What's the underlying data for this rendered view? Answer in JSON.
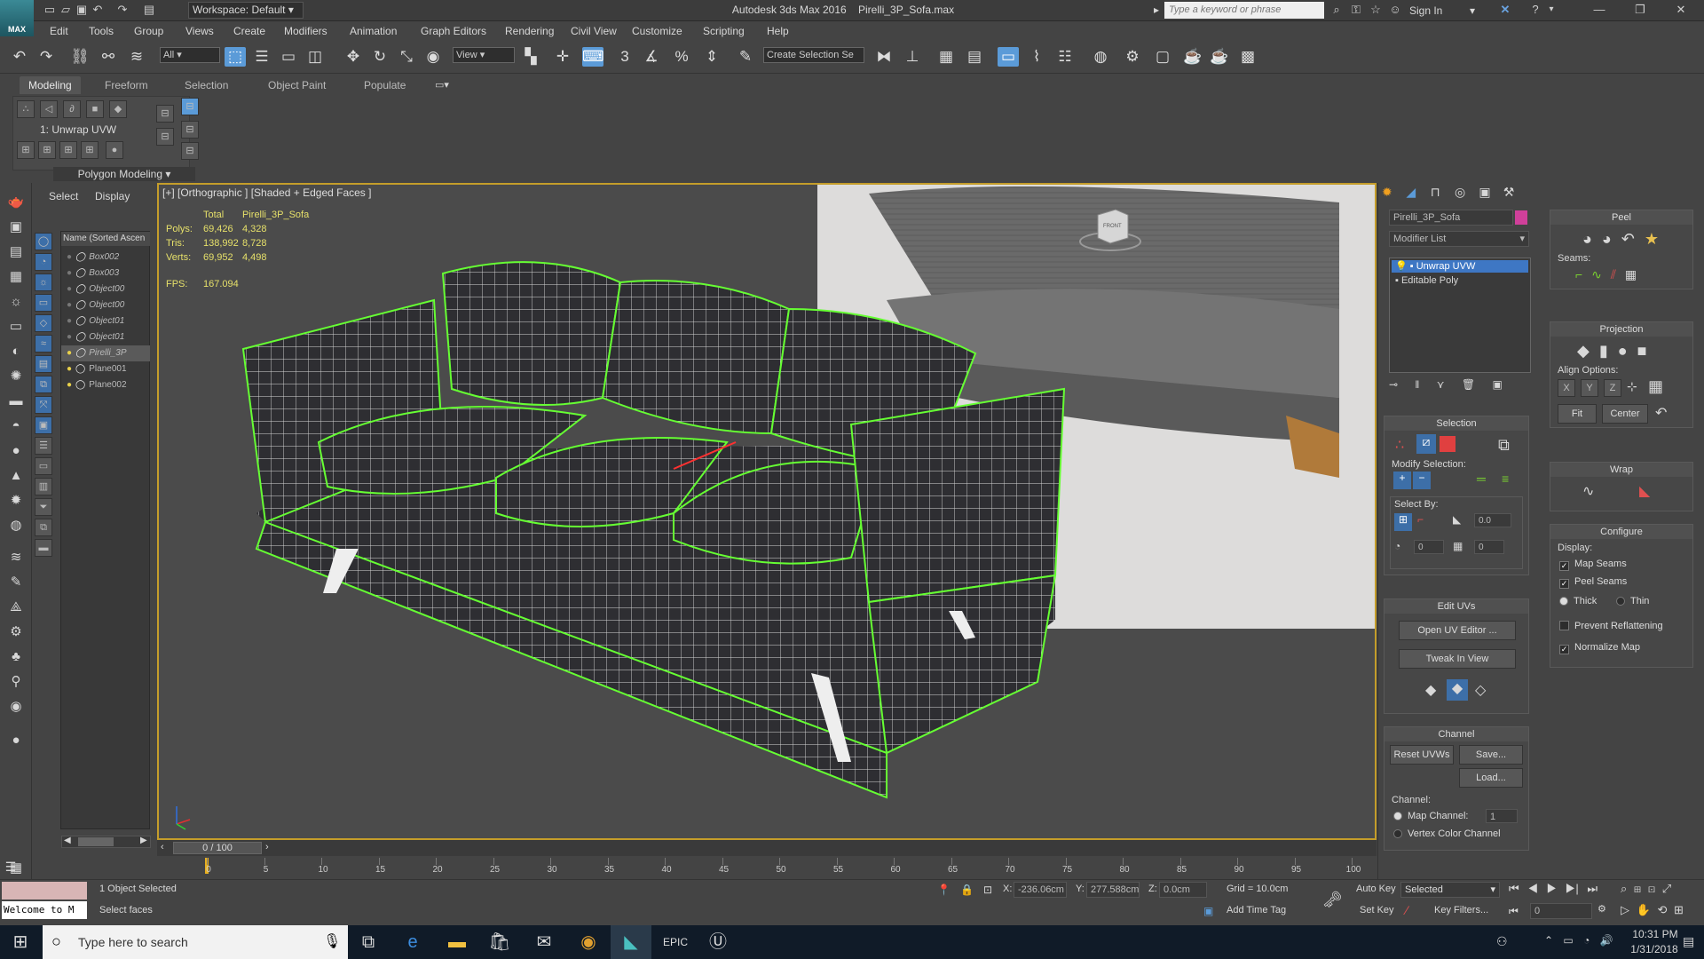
{
  "window": {
    "app_title": "Autodesk 3ds Max 2016",
    "file_name": "Pirelli_3P_Sofa.max",
    "workspace": "Workspace: Default",
    "search_placeholder": "Type a keyword or phrase",
    "sign_in": "Sign In",
    "logo_text": "MAX"
  },
  "menu": [
    "Edit",
    "Tools",
    "Group",
    "Views",
    "Create",
    "Modifiers",
    "Animation",
    "Graph Editors",
    "Rendering",
    "Civil View",
    "Customize",
    "Scripting",
    "Help"
  ],
  "toolbar": {
    "selection_filter": "All",
    "ref_coord": "View",
    "named_selection_placeholder": "Create Selection Se",
    "snap_labels": [
      "3",
      "%"
    ]
  },
  "ribbon": {
    "tabs": [
      "Modeling",
      "Freeform",
      "Selection",
      "Object Paint",
      "Populate"
    ],
    "modifier_label": "1: Unwrap UVW",
    "panel_label": "Polygon Modeling"
  },
  "scene_explorer": {
    "tabs": [
      "Select",
      "Display"
    ],
    "column_header": "Name (Sorted Ascen",
    "items": [
      "Box002",
      "Box003",
      "Object00",
      "Object00",
      "Object01",
      "Object01",
      "Pirelli_3P",
      "Plane001",
      "Plane002"
    ]
  },
  "viewport": {
    "label": "[+] [Orthographic ] [Shaded + Edged Faces ]",
    "stats": {
      "header_total": "Total",
      "header_object": "Pirelli_3P_Sofa",
      "rows": [
        {
          "label": "Polys:",
          "total": "69,426",
          "object": "4,328"
        },
        {
          "label": "Tris:",
          "total": "138,992",
          "object": "8,728"
        },
        {
          "label": "Verts:",
          "total": "69,952",
          "object": "4,498"
        }
      ],
      "fps_label": "FPS:",
      "fps_value": "167.094"
    },
    "viewcube_label": "FRONT"
  },
  "timeline": {
    "frame_display": "0 / 100",
    "ticks": [
      "0",
      "5",
      "10",
      "15",
      "20",
      "25",
      "30",
      "35",
      "40",
      "45",
      "50",
      "55",
      "60",
      "65",
      "70",
      "75",
      "80",
      "85",
      "90",
      "95",
      "100"
    ]
  },
  "command_panel": {
    "object_name": "Pirelli_3P_Sofa",
    "object_color": "#d0409a",
    "modifier_list_label": "Modifier List",
    "stack": [
      "Unwrap UVW",
      "Editable Poly"
    ],
    "selection": {
      "title": "Selection",
      "modify_label": "Modify Selection:",
      "select_by_label": "Select By:",
      "spin1": "0.0",
      "spin2": "0",
      "spin3": "0"
    },
    "edit_uvs": {
      "title": "Edit UVs",
      "open_editor": "Open UV Editor ...",
      "tweak": "Tweak In View"
    },
    "channel": {
      "title": "Channel",
      "reset": "Reset UVWs",
      "save": "Save...",
      "load": "Load...",
      "channel_label": "Channel:",
      "map_channel": "Map Channel:",
      "map_channel_value": "1",
      "vertex_color": "Vertex Color Channel"
    }
  },
  "peel_panel": {
    "peel_title": "Peel",
    "seams_label": "Seams:",
    "projection_title": "Projection",
    "align_label": "Align Options:",
    "axes": [
      "X",
      "Y",
      "Z"
    ],
    "fit": "Fit",
    "center": "Center",
    "wrap_title": "Wrap",
    "configure_title": "Configure",
    "display_label": "Display:",
    "map_seams": "Map Seams",
    "peel_seams": "Peel Seams",
    "thick": "Thick",
    "thin": "Thin",
    "prevent_reflattening": "Prevent Reflattening",
    "normalize_map": "Normalize Map"
  },
  "statusbar": {
    "script_text": "Welcome to M",
    "objects_selected": "1 Object Selected",
    "prompt": "Select faces",
    "x_label": "X:",
    "x_value": "-236.06cm",
    "y_label": "Y:",
    "y_value": "277.588cm",
    "z_label": "Z:",
    "z_value": "0.0cm",
    "grid": "Grid = 10.0cm",
    "add_time_tag": "Add Time Tag",
    "auto_key": "Auto Key",
    "set_key": "Set Key",
    "key_mode": "Selected",
    "key_filters": "Key Filters...",
    "frame_value": "0"
  },
  "taskbar": {
    "search_placeholder": "Type here to search",
    "time": "10:31 PM",
    "date": "1/31/2018"
  }
}
